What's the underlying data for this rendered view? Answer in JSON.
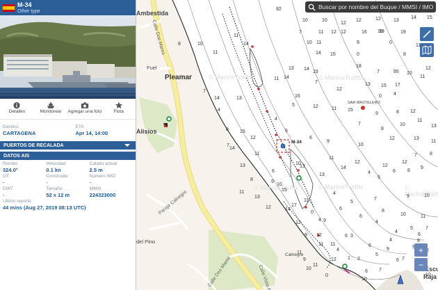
{
  "vessel": {
    "name": "M-34",
    "type": "Other type"
  },
  "actions": [
    {
      "label": "Detalles",
      "icon": "info-icon"
    },
    {
      "label": "Monitorear",
      "icon": "ship-icon"
    },
    {
      "label": "Agregar una foto",
      "icon": "camera-icon"
    },
    {
      "label": "Flota",
      "icon": "star-icon"
    }
  ],
  "voyage": {
    "destination_label": "Destino",
    "destination_value": "CARTAGENA",
    "eta_label": "ETA",
    "eta_value": "Apr 14, 14:00"
  },
  "sections": {
    "ports": "PUERTOS DE RECALADA",
    "ais": "DATOS AIS"
  },
  "ais": {
    "course_label": "Rumbo",
    "course_value": "324.0°",
    "speed_label": "Velocidad",
    "speed_value": "0.1 kn",
    "draft_label": "Calado actual",
    "draft_value": "2.5 m",
    "gt_label": "GT",
    "gt_value": "-",
    "built_label": "Construido",
    "built_value": "-",
    "imo_label": "Numero IMO",
    "imo_value": "-",
    "dwt_label": "DWT",
    "dwt_value": "-",
    "size_label": "Tamaño",
    "size_value": "52 x 12 m",
    "mmsi_label": "MMSI",
    "mmsi_value": "224323000",
    "last_report_label": "Ultimo reporte",
    "last_report_value": "44 mins (Aug 27, 2019 08:13 UTC)"
  },
  "search": {
    "placeholder": "Buscar por nombre del Buque / MMSI / IMO"
  },
  "map": {
    "places": {
      "ambestida": "Ambestida",
      "fuel": "Fuel",
      "pleamar": "Pleamar",
      "alisios": "Alisios",
      "del_pino": "del Pino",
      "calnegre": "Calnegre",
      "escu": "Escu",
      "raja": "Raja",
      "sar_mastelero": "SAR MASTELERO",
      "vessel_label": "M-34"
    },
    "streets": {
      "dos_mares": "Calle Dos Mares",
      "calnegre_st": "Paraje Calnegre",
      "vista_ajo": "Calle Vista Ajo",
      "dos_mares_2": "Calle Dos Mares"
    },
    "watermarks": [
      "© MarineTraffic",
      "© MarineTraffic",
      "© MarineTraffic",
      "© MarineTraffic",
      "© MarineTraffic"
    ],
    "depths": [
      "92",
      "10",
      "10",
      "12",
      "12",
      "12",
      "13",
      "14",
      "15",
      "18",
      "7",
      "10",
      "11",
      "12",
      "11",
      "12",
      "16",
      "19",
      "19",
      "8",
      "8",
      "10",
      "11",
      "11",
      "14",
      "14",
      "15",
      "9",
      "0",
      "0",
      "8",
      "11",
      "13",
      "13",
      "14",
      "15",
      "18",
      "7",
      "95",
      "10",
      "11",
      "12",
      "14",
      "13",
      "14",
      "16",
      "7",
      "12",
      "13",
      "15",
      "17",
      "0",
      "4",
      "7",
      "4",
      "8",
      "11",
      "12",
      "11",
      "15",
      "9",
      "8",
      "12",
      "15",
      "12",
      "4",
      "5",
      "7",
      "8",
      "10",
      "11",
      "13",
      "14",
      "13",
      "11",
      "6",
      "6",
      "6",
      "9",
      "10",
      "12",
      "13",
      "11",
      "7",
      "8",
      "9",
      "10",
      "11",
      "12",
      "12",
      "12",
      "7",
      "8",
      "10",
      "13",
      "13",
      "14",
      "4",
      "5",
      "6",
      "8",
      "9",
      "11",
      "13",
      "15",
      "17",
      "0",
      "4",
      "5",
      "7",
      "9",
      "10",
      "12",
      "14",
      "11",
      "4",
      "6",
      "6",
      "8",
      "10",
      "11",
      "12",
      "12",
      "11",
      "3",
      "4",
      "4",
      "5",
      "6",
      "7",
      "9",
      "11",
      "12",
      "2",
      "5",
      "9",
      "7",
      "9",
      "10",
      "11",
      "11",
      "0",
      "1",
      "6",
      "7",
      "6",
      "10",
      "9",
      "9",
      "10",
      "4",
      "6",
      "6",
      "4",
      "8",
      "10",
      "10",
      "8",
      "2",
      "6",
      "6",
      "7",
      "9",
      "4",
      "5",
      "8",
      "8",
      "9"
    ],
    "colors": {
      "land": "#f7f3ec",
      "sea": "#ffffff",
      "road": "#f6ec9c",
      "park": "#dde8c7",
      "panel_header": "#2c5e98"
    }
  }
}
